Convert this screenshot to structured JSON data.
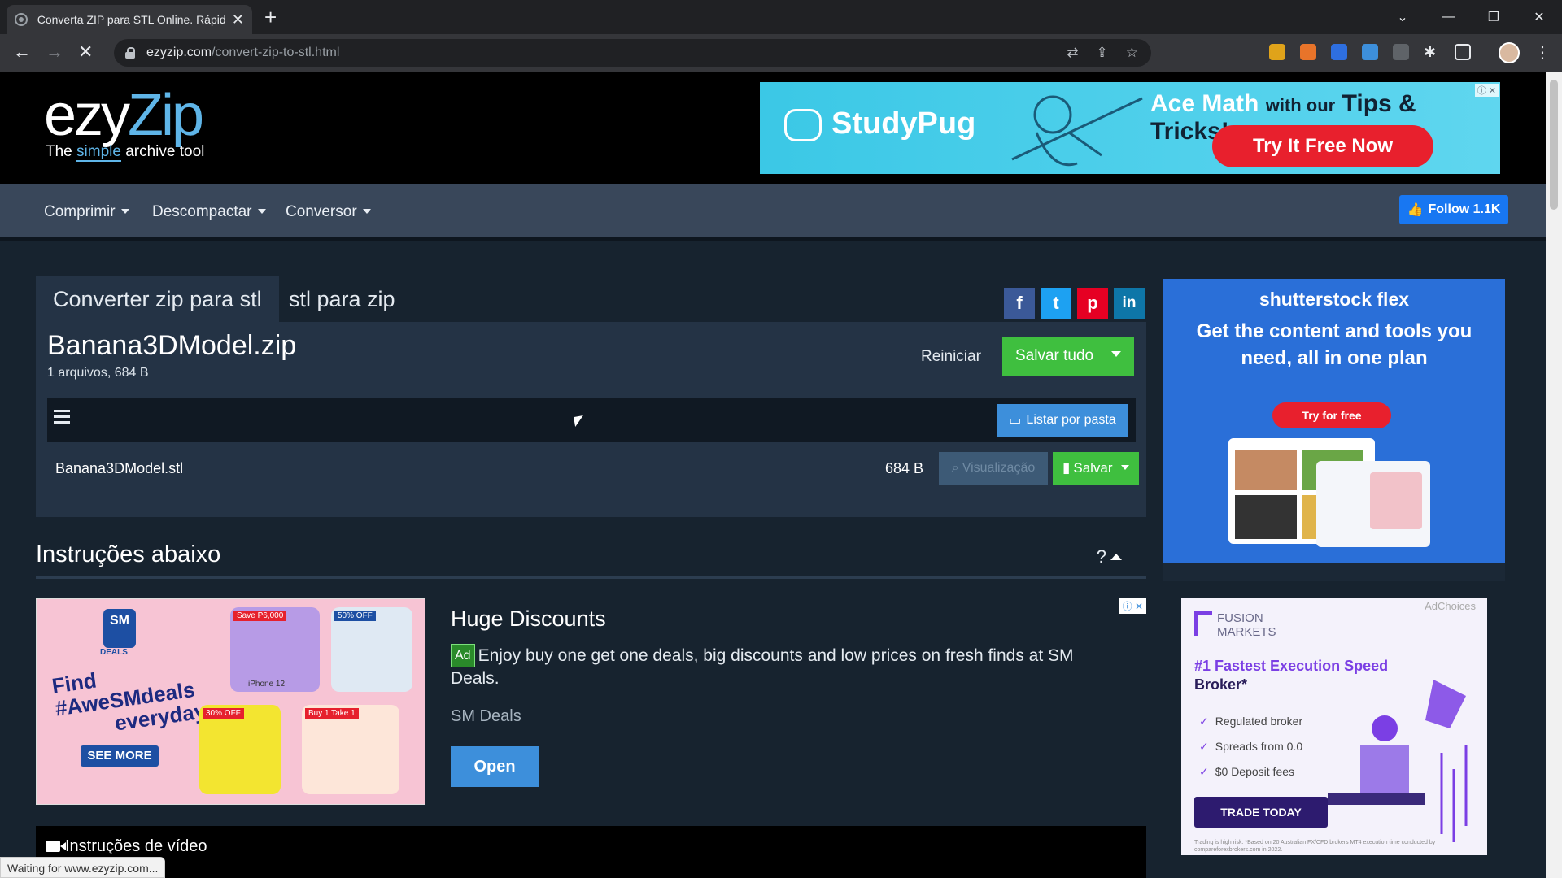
{
  "browser": {
    "tab_title": "Converta ZIP para STL Online. Rápido e Seguro",
    "url_host": "ezyzip.com",
    "url_path": "/convert-zip-to-stl.html",
    "status_text": "Waiting for www.ezyzip.com..."
  },
  "header": {
    "logo_ezy": "ezy",
    "logo_zip": "Zip",
    "tag_the": "The",
    "tag_simple": "simple",
    "tag_rest": "archive tool",
    "ad": {
      "brand": "StudyPug",
      "headline_a": "Ace Math",
      "headline_b": "with our",
      "headline_c": "Tips & Tricks!",
      "cta": "Try It Free Now"
    }
  },
  "nav": {
    "items": [
      "Comprimir",
      "Descompactar",
      "Conversor"
    ],
    "follow_label": "Follow 1.1K"
  },
  "tool": {
    "tabs": [
      "Converter zip para stl",
      "stl para zip"
    ],
    "file_title": "Banana3DModel.zip",
    "file_meta": "1 arquivos, 684 B",
    "reset_label": "Reiniciar",
    "save_all_label": "Salvar tudo",
    "list_folder_label": "Listar por pasta",
    "rows": [
      {
        "name": "Banana3DModel.stl",
        "size": "684 B",
        "preview_label": "Visualização",
        "save_label": "Salvar"
      }
    ]
  },
  "instructions": {
    "title": "Instruções abaixo",
    "toggle": "?"
  },
  "native_ad": {
    "img_brand": "SM",
    "img_deals": "DEALS",
    "img_find": "Find",
    "img_hashtag": "#AweSMdeals",
    "img_everyday": "everyday",
    "img_see_more": "SEE MORE",
    "img_save": "Save P6,000",
    "img_iphone": "iPhone 12",
    "img_50off": "50% OFF",
    "img_30off": "30% OFF",
    "img_b1t1": "Buy 1 Take 1",
    "headline": "Huge Discounts",
    "badge": "Ad",
    "description": "Enjoy buy one get one deals, big discounts and low prices on fresh finds at SM Deals.",
    "advertiser": "SM Deals",
    "cta": "Open"
  },
  "video": {
    "title": "Instruções de vídeo"
  },
  "side_ad1": {
    "logo": "shutterstock flex",
    "headline": "Get the content and tools you need, all in one plan",
    "cta": "Try for free"
  },
  "side_ad2": {
    "brand_a": "FUSION",
    "brand_b": "MARKETS",
    "adchoices": "AdChoices",
    "headline_a": "#1 Fastest Execution Speed",
    "headline_b": "Broker*",
    "features": [
      "Regulated broker",
      "Spreads from 0.0",
      "$0 Deposit fees"
    ],
    "cta": "TRADE TODAY",
    "fine_print": "Trading is high risk. *Based on 20 Australian FX/CFD brokers MT4 execution time conducted by compareforexbrokers.com in 2022."
  },
  "colors": {
    "page_bg": "#17232f",
    "panel_bg": "#243345",
    "navbar_bg": "#39475a",
    "green": "#3fbf3f",
    "blue": "#3d8fdb",
    "logo_accent": "#5fb5e8"
  }
}
